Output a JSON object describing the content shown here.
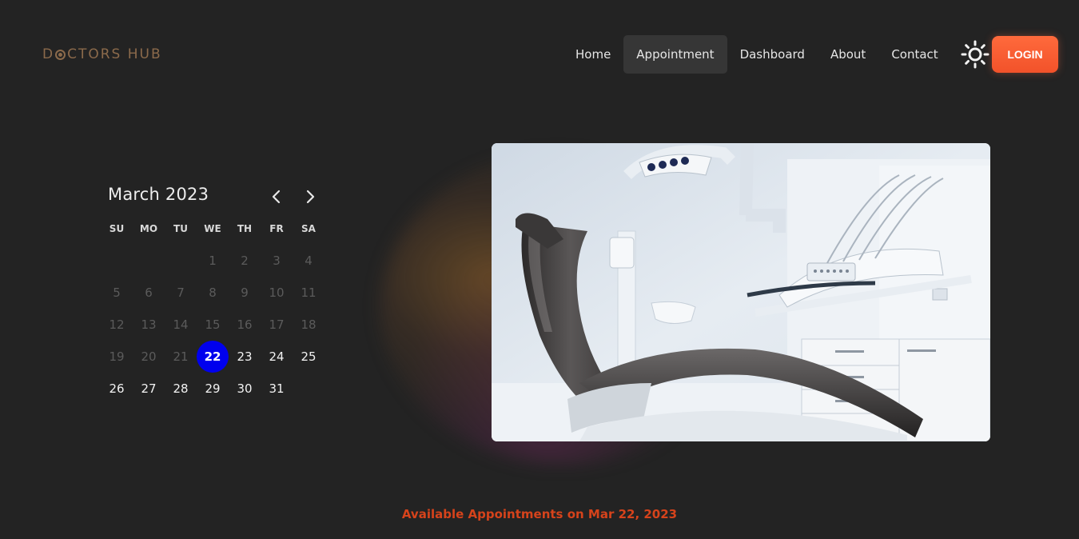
{
  "brand": {
    "logo_text_before": "D",
    "logo_text_after": "CTORS HUB",
    "logo_color": "#8b6a4b"
  },
  "nav": {
    "items": [
      {
        "label": "Home",
        "active": false
      },
      {
        "label": "Appointment",
        "active": true
      },
      {
        "label": "Dashboard",
        "active": false
      },
      {
        "label": "About",
        "active": false
      },
      {
        "label": "Contact",
        "active": false
      }
    ]
  },
  "header": {
    "theme_toggle_icon": "sun-icon",
    "login_label": "LOGIN",
    "login_color": "#f95a30"
  },
  "calendar": {
    "month_label": "March 2023",
    "prev_icon": "chevron-left-icon",
    "next_icon": "chevron-right-icon",
    "weekdays": [
      "SU",
      "MO",
      "TU",
      "WE",
      "TH",
      "FR",
      "SA"
    ],
    "leading_blanks": 3,
    "days": [
      {
        "n": "1",
        "disabled": true
      },
      {
        "n": "2",
        "disabled": true
      },
      {
        "n": "3",
        "disabled": true
      },
      {
        "n": "4",
        "disabled": true
      },
      {
        "n": "5",
        "disabled": true
      },
      {
        "n": "6",
        "disabled": true
      },
      {
        "n": "7",
        "disabled": true
      },
      {
        "n": "8",
        "disabled": true
      },
      {
        "n": "9",
        "disabled": true
      },
      {
        "n": "10",
        "disabled": true
      },
      {
        "n": "11",
        "disabled": true
      },
      {
        "n": "12",
        "disabled": true
      },
      {
        "n": "13",
        "disabled": true
      },
      {
        "n": "14",
        "disabled": true
      },
      {
        "n": "15",
        "disabled": true
      },
      {
        "n": "16",
        "disabled": true
      },
      {
        "n": "17",
        "disabled": true
      },
      {
        "n": "18",
        "disabled": true
      },
      {
        "n": "19",
        "disabled": true
      },
      {
        "n": "20",
        "disabled": true
      },
      {
        "n": "21",
        "disabled": true
      },
      {
        "n": "22",
        "disabled": false,
        "selected": true
      },
      {
        "n": "23",
        "disabled": false
      },
      {
        "n": "24",
        "disabled": false
      },
      {
        "n": "25",
        "disabled": false
      },
      {
        "n": "26",
        "disabled": false
      },
      {
        "n": "27",
        "disabled": false
      },
      {
        "n": "28",
        "disabled": false
      },
      {
        "n": "29",
        "disabled": false
      },
      {
        "n": "30",
        "disabled": false
      },
      {
        "n": "31",
        "disabled": false
      }
    ],
    "selected_color": "#0000ee"
  },
  "hero": {
    "image_icon": "dental-chair-image"
  },
  "appointments": {
    "heading": "Available Appointments on Mar 22, 2023",
    "heading_color": "#d6431b"
  }
}
